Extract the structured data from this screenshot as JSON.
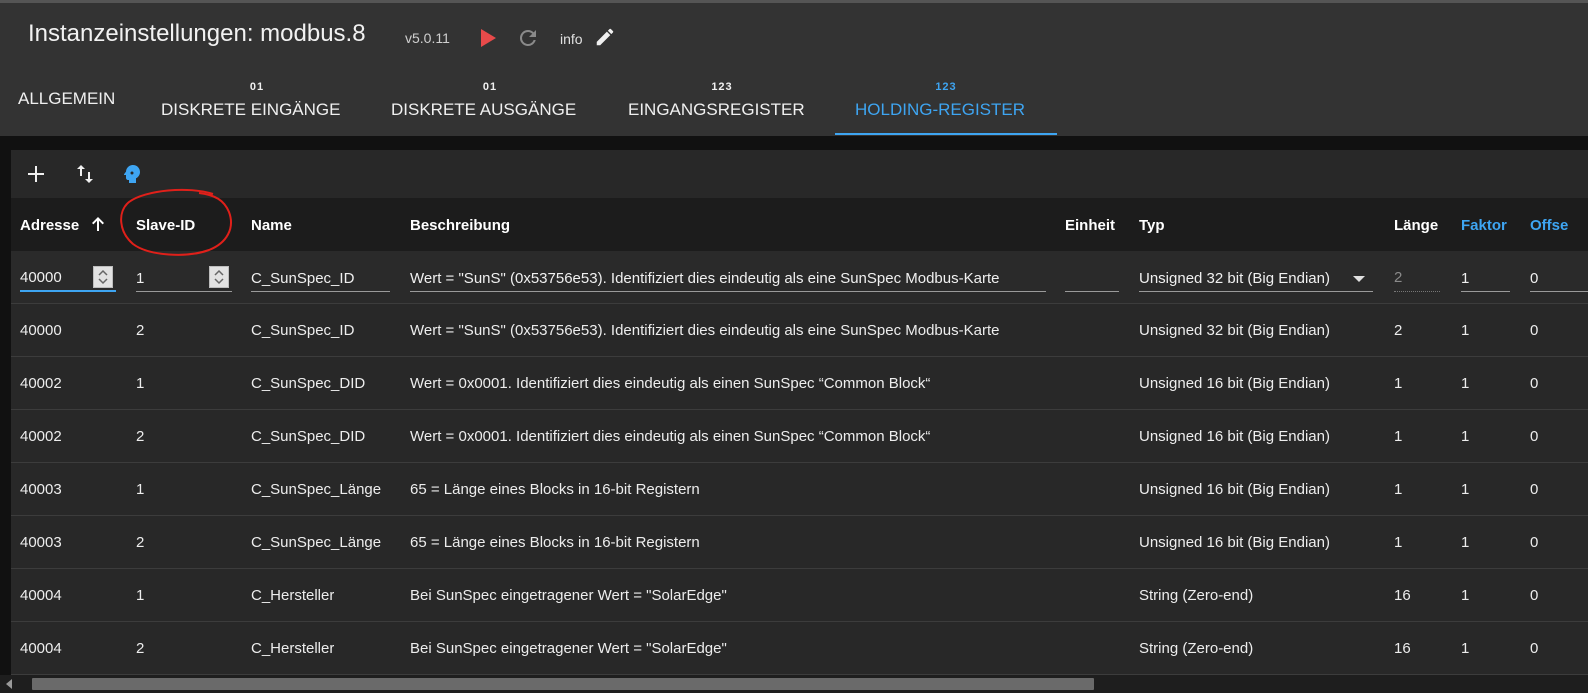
{
  "header": {
    "title": "Instanzeinstellungen: modbus.8",
    "version": "v5.0.11",
    "info_label": "info"
  },
  "tabs": [
    {
      "icon": "",
      "label": "ALLGEMEIN"
    },
    {
      "icon": "01",
      "label": "DISKRETE EINGÄNGE"
    },
    {
      "icon": "01",
      "label": "DISKRETE AUSGÄNGE"
    },
    {
      "icon": "123",
      "label": "EINGANGSREGISTER"
    },
    {
      "icon": "123",
      "label": "HOLDING-REGISTER"
    }
  ],
  "active_tab": "HOLDING-REGISTER",
  "toolbar": {
    "icons": [
      "plus-icon",
      "import-export-icon",
      "head-icon"
    ]
  },
  "table": {
    "columns": [
      "Adresse",
      "Slave-ID",
      "Name",
      "Beschreibung",
      "Einheit",
      "Typ",
      "Länge",
      "Faktor",
      "Offse"
    ],
    "edit_row": {
      "address": "40000",
      "slave_id": "1",
      "name": "C_SunSpec_ID",
      "description": "Wert = \"SunS\" (0x53756e53). Identifiziert dies eindeutig als eine SunSpec Modbus-Karte",
      "unit": "",
      "type": "Unsigned 32 bit (Big Endian)",
      "length": "2",
      "factor": "1",
      "offset": "0"
    },
    "rows": [
      {
        "address": "40000",
        "slave_id": "2",
        "name": "C_SunSpec_ID",
        "description": "Wert = \"SunS\" (0x53756e53). Identifiziert dies eindeutig als eine SunSpec Modbus-Karte",
        "unit": "",
        "type": "Unsigned 32 bit (Big Endian)",
        "length": "2",
        "factor": "1",
        "offset": "0"
      },
      {
        "address": "40002",
        "slave_id": "1",
        "name": "C_SunSpec_DID",
        "description": "Wert = 0x0001. Identifiziert dies eindeutig als einen SunSpec “Common Block“",
        "unit": "",
        "type": "Unsigned 16 bit (Big Endian)",
        "length": "1",
        "factor": "1",
        "offset": "0"
      },
      {
        "address": "40002",
        "slave_id": "2",
        "name": "C_SunSpec_DID",
        "description": "Wert = 0x0001. Identifiziert dies eindeutig als einen SunSpec “Common Block“",
        "unit": "",
        "type": "Unsigned 16 bit (Big Endian)",
        "length": "1",
        "factor": "1",
        "offset": "0"
      },
      {
        "address": "40003",
        "slave_id": "1",
        "name": "C_SunSpec_Länge",
        "description": "65 = Länge eines Blocks in 16-bit Registern",
        "unit": "",
        "type": "Unsigned 16 bit (Big Endian)",
        "length": "1",
        "factor": "1",
        "offset": "0"
      },
      {
        "address": "40003",
        "slave_id": "2",
        "name": "C_SunSpec_Länge",
        "description": "65 = Länge eines Blocks in 16-bit Registern",
        "unit": "",
        "type": "Unsigned 16 bit (Big Endian)",
        "length": "1",
        "factor": "1",
        "offset": "0"
      },
      {
        "address": "40004",
        "slave_id": "1",
        "name": "C_Hersteller",
        "description": "Bei SunSpec eingetragener Wert = \"SolarEdge\"",
        "unit": "",
        "type": "String (Zero-end)",
        "length": "16",
        "factor": "1",
        "offset": "0"
      },
      {
        "address": "40004",
        "slave_id": "2",
        "name": "C_Hersteller",
        "description": "Bei SunSpec eingetragener Wert = \"SolarEdge\"",
        "unit": "",
        "type": "String (Zero-end)",
        "length": "16",
        "factor": "1",
        "offset": "0"
      }
    ]
  },
  "colors": {
    "accent": "#3ea5f2",
    "play": "#e84a4a",
    "annotation": "#e0201a"
  }
}
